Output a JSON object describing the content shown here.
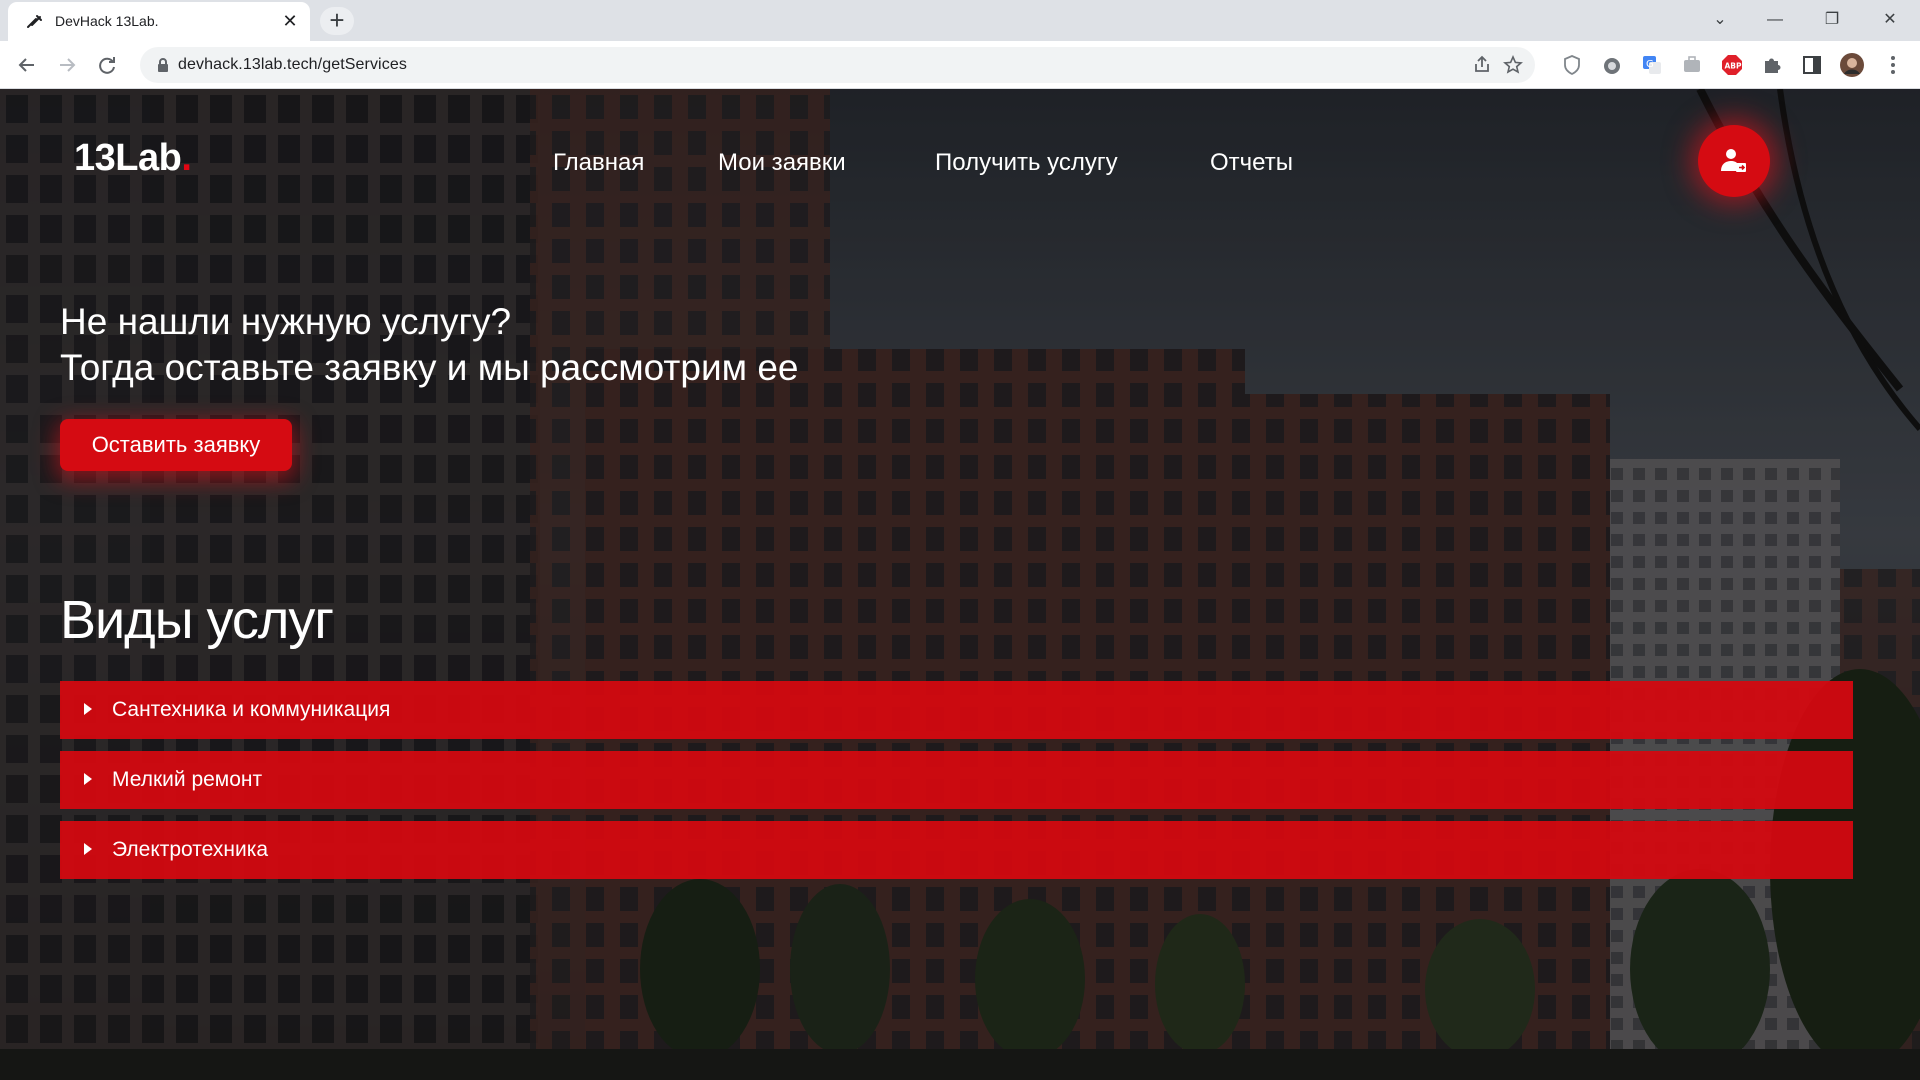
{
  "browser": {
    "tab_title": "DevHack 13Lab.",
    "tab_close": "✕",
    "new_tab": "+",
    "url": "devhack.13lab.tech/getServices",
    "controls": {
      "dropdown": "⌄",
      "minimize": "—",
      "restore": "❐",
      "close": "✕"
    }
  },
  "header": {
    "logo_text": "13Lab",
    "logo_dot": ".",
    "menu": [
      "Главная",
      "Мои заявки",
      "Получить услугу",
      "Отчеты"
    ]
  },
  "hero": {
    "title_line1": "Не нашли нужную услугу?",
    "title_line2": "Тогда оставьте заявку и мы рассмотрим ее",
    "button": "Оставить заявку"
  },
  "services": {
    "title": "Виды услуг",
    "items": [
      "Сантехника и коммуникация",
      "Мелкий ремонт",
      "Электротехника"
    ]
  },
  "colors": {
    "accent": "#d50b12",
    "logo_dot": "#e30613"
  }
}
